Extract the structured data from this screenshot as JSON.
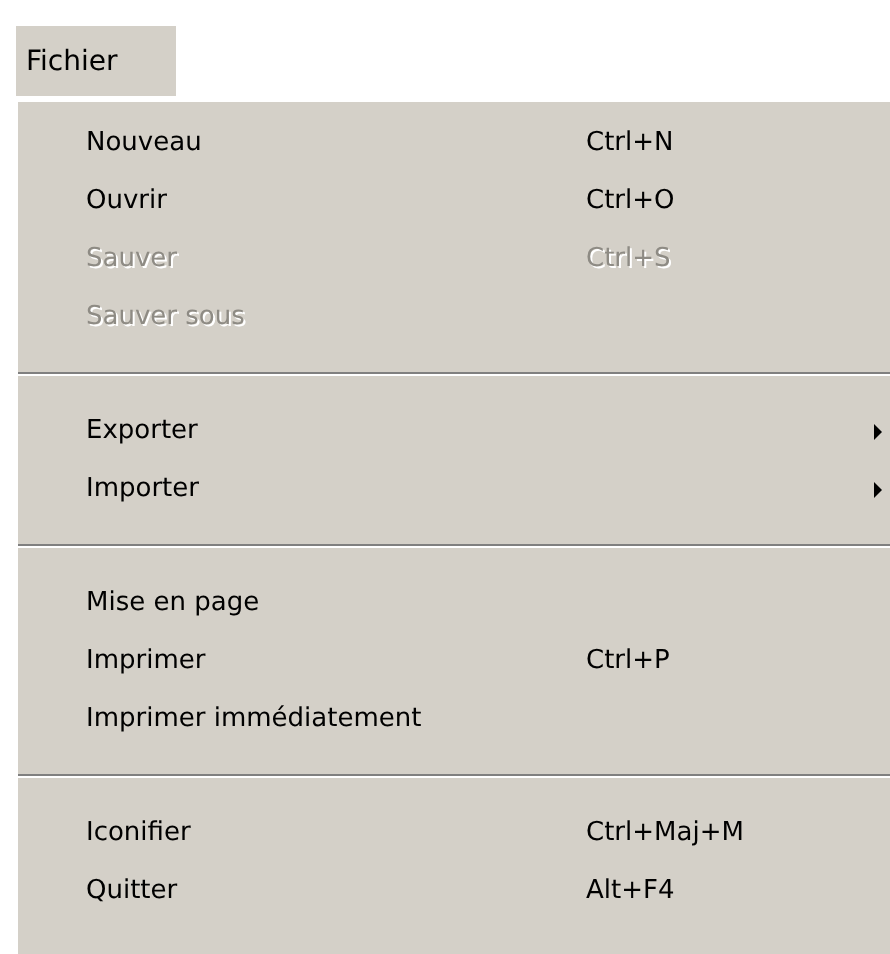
{
  "menu": {
    "title": "Fichier",
    "groups": [
      [
        {
          "label": "Nouveau",
          "shortcut": "Ctrl+N",
          "disabled": false,
          "submenu": false
        },
        {
          "label": "Ouvrir",
          "shortcut": "Ctrl+O",
          "disabled": false,
          "submenu": false
        },
        {
          "label": "Sauver",
          "shortcut": "Ctrl+S",
          "disabled": true,
          "submenu": false
        },
        {
          "label": "Sauver sous",
          "disabled": true,
          "submenu": false
        }
      ],
      [
        {
          "label": "Exporter",
          "disabled": false,
          "submenu": true
        },
        {
          "label": "Importer",
          "disabled": false,
          "submenu": true
        }
      ],
      [
        {
          "label": "Mise en page",
          "disabled": false,
          "submenu": false
        },
        {
          "label": "Imprimer",
          "shortcut": "Ctrl+P",
          "disabled": false,
          "submenu": false
        },
        {
          "label": "Imprimer immédiatement",
          "disabled": false,
          "submenu": false
        }
      ],
      [
        {
          "label": "Iconifier",
          "shortcut": "Ctrl+Maj+M",
          "disabled": false,
          "submenu": false
        },
        {
          "label": "Quitter",
          "shortcut": "Alt+F4",
          "disabled": false,
          "submenu": false
        }
      ]
    ]
  }
}
